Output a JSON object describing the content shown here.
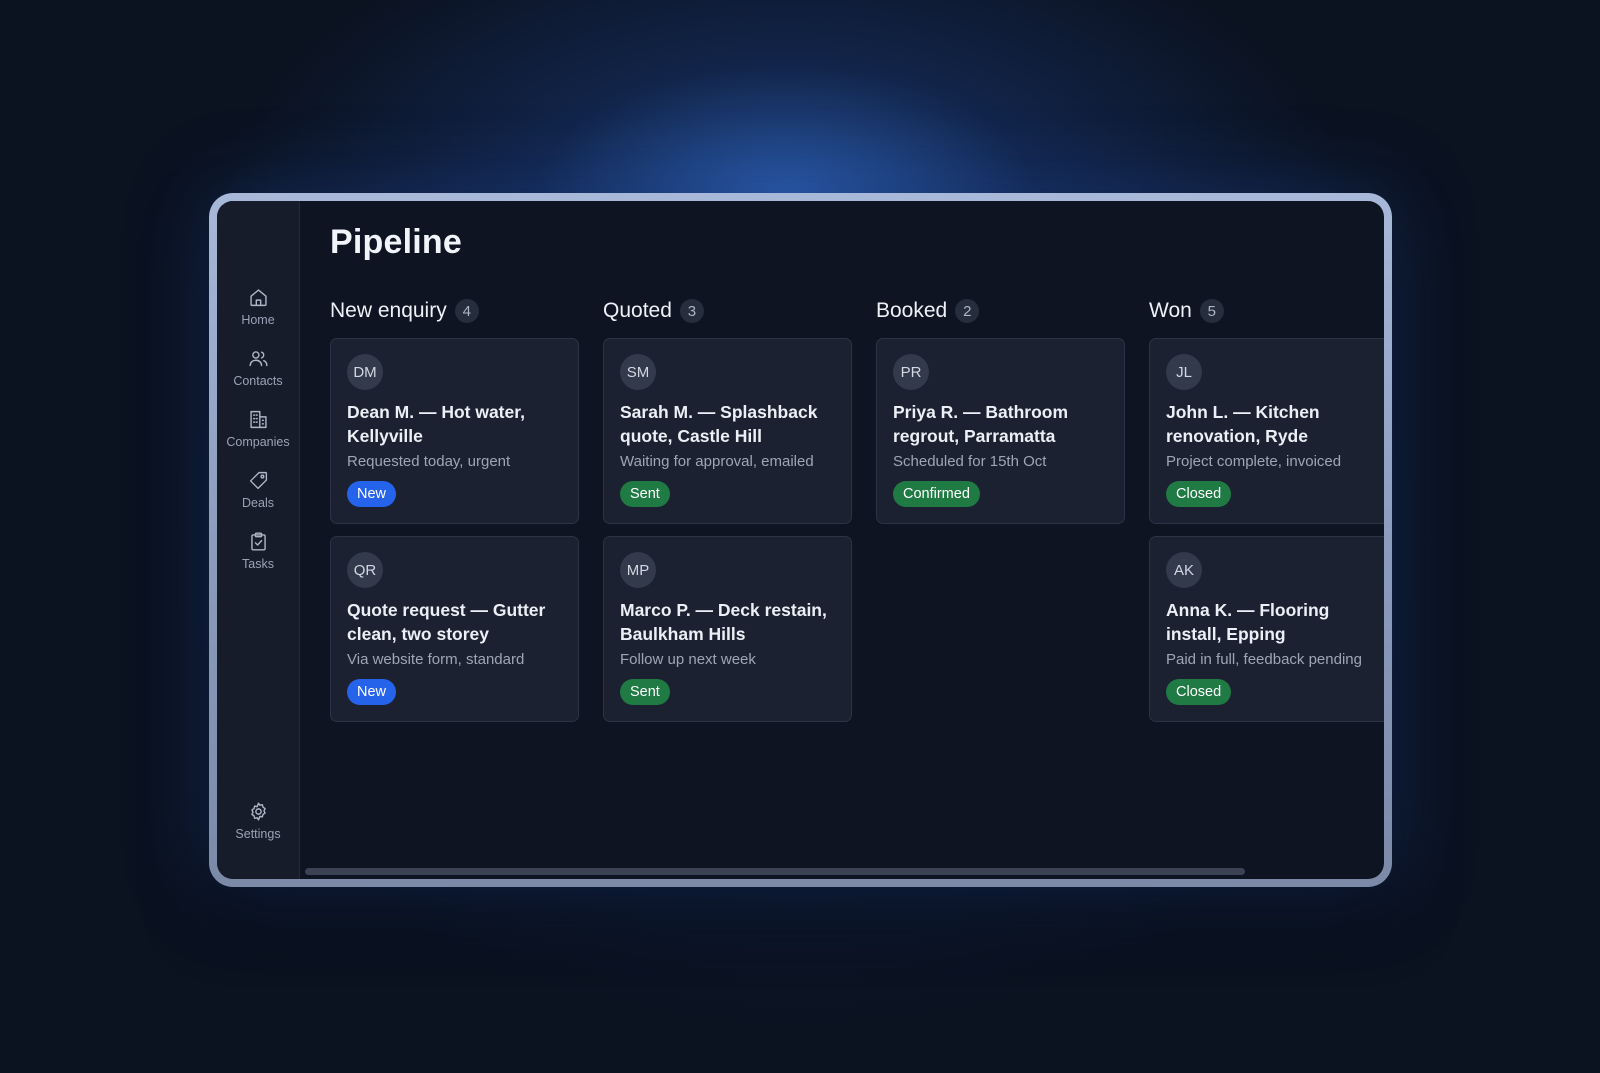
{
  "page": {
    "title": "Pipeline"
  },
  "sidebar": {
    "items": [
      {
        "label": "Home",
        "icon": "home-icon"
      },
      {
        "label": "Contacts",
        "icon": "users-icon"
      },
      {
        "label": "Companies",
        "icon": "building-icon"
      },
      {
        "label": "Deals",
        "icon": "tag-icon"
      },
      {
        "label": "Tasks",
        "icon": "clipboard-check-icon"
      }
    ],
    "settings": {
      "label": "Settings",
      "icon": "gear-icon"
    }
  },
  "columns": [
    {
      "title": "New enquiry",
      "count": "4",
      "cards": [
        {
          "initials": "DM",
          "title": "Dean M. — Hot water, Kellyville",
          "subtitle": "Requested today, urgent",
          "status": "New"
        },
        {
          "initials": "QR",
          "title": "Quote request — Gutter clean, two storey",
          "subtitle": "Via website form, standard",
          "status": "New"
        }
      ]
    },
    {
      "title": "Quoted",
      "count": "3",
      "cards": [
        {
          "initials": "SM",
          "title": "Sarah M. — Splashback quote, Castle Hill",
          "subtitle": "Waiting for approval, emailed",
          "status": "Sent"
        },
        {
          "initials": "MP",
          "title": "Marco P. — Deck restain, Baulkham Hills",
          "subtitle": "Follow up next week",
          "status": "Sent"
        }
      ]
    },
    {
      "title": "Booked",
      "count": "2",
      "cards": [
        {
          "initials": "PR",
          "title": "Priya R. — Bathroom regrout, Parramatta",
          "subtitle": "Scheduled for 15th Oct",
          "status": "Confirmed"
        }
      ]
    },
    {
      "title": "Won",
      "count": "5",
      "cards": [
        {
          "initials": "JL",
          "title": "John L. — Kitchen renovation, Ryde",
          "subtitle": "Project complete, invoiced",
          "status": "Closed"
        },
        {
          "initials": "AK",
          "title": "Anna K. — Flooring install, Epping",
          "subtitle": "Paid in full, feedback pending",
          "status": "Closed"
        }
      ]
    }
  ],
  "colors": {
    "status_new": "#2563eb",
    "status_sent": "#1f7a44",
    "status_confirmed": "#1f7a44",
    "status_closed": "#1f7a44"
  }
}
